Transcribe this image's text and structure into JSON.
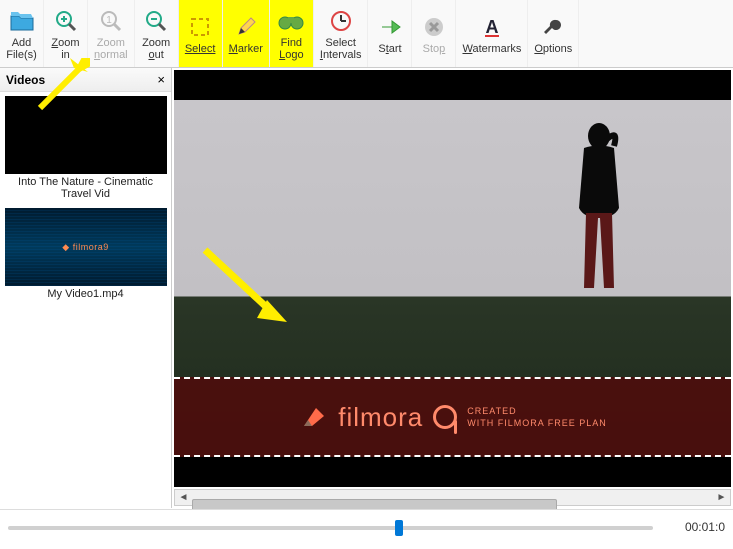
{
  "toolbar": {
    "add_files": "Add\nFile(s)",
    "zoom_in": "Zoom\nin",
    "zoom_normal": "Zoom\nnormal",
    "zoom_out": "Zoom\nout",
    "select": "Select",
    "marker": "Marker",
    "find_logo": "Find\nLogo",
    "select_intervals": "Select\nIntervals",
    "start": "Start",
    "stop": "Stop",
    "watermarks": "Watermarks",
    "options": "Options"
  },
  "sidebar": {
    "title": "Videos",
    "close": "×",
    "items": [
      {
        "name": "Into The Nature - Cinematic Travel Vid"
      },
      {
        "name": "My Video1.mp4"
      }
    ]
  },
  "watermark": {
    "brand": "filmora",
    "line1": "CREATED",
    "line2": "WITH FILMORA FREE PLAN"
  },
  "timeline": {
    "time": "00:01:0",
    "position_pct": 60
  },
  "icons": {
    "folder": "folder-icon",
    "zoom_in": "zoom-in-icon",
    "zoom_normal": "zoom-reset-icon",
    "zoom_out": "zoom-out-icon",
    "select": "dashed-select-icon",
    "marker": "pencil-icon",
    "find_logo": "binoculars-icon",
    "intervals": "clock-icon",
    "start": "arrow-right-icon",
    "stop": "x-circle-icon",
    "watermarks": "text-a-icon",
    "options": "wrench-icon"
  },
  "colors": {
    "highlight": "#ffff00",
    "arrow": "#ffee00",
    "accent": "#0078d7",
    "wm_text": "#ff8a6b"
  }
}
